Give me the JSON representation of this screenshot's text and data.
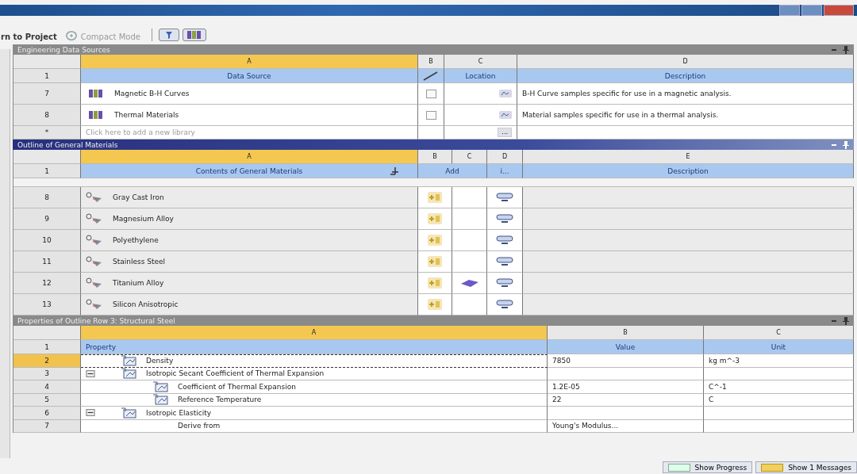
{
  "toolbar": {
    "return_label": "rn to Project",
    "compact_label": "Compact Mode"
  },
  "sources": {
    "title": "Engineering Data Sources",
    "letters": [
      "A",
      "B",
      "C",
      "D"
    ],
    "header_num": "1",
    "headers": [
      "Data Source",
      "Location",
      "Description"
    ],
    "rows": [
      {
        "num": "7",
        "name": "Magnetic B-H Curves",
        "checked": false,
        "description": "B-H Curve samples specific for use in a magnetic analysis."
      },
      {
        "num": "8",
        "name": "Thermal Materials",
        "checked": false,
        "description": "Material samples specific for use in a thermal analysis."
      }
    ],
    "add_row": {
      "num": "*",
      "placeholder": "Click here to add a new library",
      "browse": "..."
    }
  },
  "outline": {
    "title": "Outline of General Materials",
    "letters": [
      "A",
      "B",
      "C",
      "D",
      "E"
    ],
    "header_num": "1",
    "headers": [
      "Contents of General Materials",
      "Add",
      "i...",
      "Description"
    ],
    "rows": [
      {
        "num": "8",
        "name": "Gray Cast Iron",
        "source_icon": false
      },
      {
        "num": "9",
        "name": "Magnesium Alloy",
        "source_icon": false
      },
      {
        "num": "10",
        "name": "Polyethylene",
        "source_icon": false
      },
      {
        "num": "11",
        "name": "Stainless Steel",
        "source_icon": false
      },
      {
        "num": "12",
        "name": "Titanium Alloy",
        "source_icon": true
      },
      {
        "num": "13",
        "name": "Silicon Anisotropic",
        "source_icon": false
      }
    ]
  },
  "properties": {
    "title": "Properties of Outline Row 3: Structural Steel",
    "letters": [
      "A",
      "B",
      "C"
    ],
    "header_num": "1",
    "headers": [
      "Property",
      "Value",
      "Unit"
    ],
    "rows": [
      {
        "num": "2",
        "name": "Density",
        "value": "7850",
        "unit": "kg m^-3",
        "selected": true,
        "icon": true
      },
      {
        "num": "3",
        "name": "Isotropic Secant Coefficient of Thermal Expansion",
        "selected": false,
        "icon": true,
        "expanded": true,
        "children": [
          {
            "num": "4",
            "name": "Coefficient of Thermal Expansion",
            "value": "1.2E-05",
            "unit": "C^-1",
            "selected": false,
            "icon": true
          },
          {
            "num": "5",
            "name": "Reference Temperature",
            "value": "22",
            "unit": "C",
            "selected": false,
            "icon": true
          }
        ]
      },
      {
        "num": "6",
        "name": "Isotropic Elasticity",
        "selected": false,
        "icon": true,
        "expanded": true,
        "children": [
          {
            "num": "7",
            "name": "Derive from",
            "value": "Young's Modulus...",
            "selected": false,
            "icon": false
          }
        ]
      }
    ]
  },
  "status": {
    "progress": "Show Progress",
    "messages": "Show 1 Messages"
  }
}
